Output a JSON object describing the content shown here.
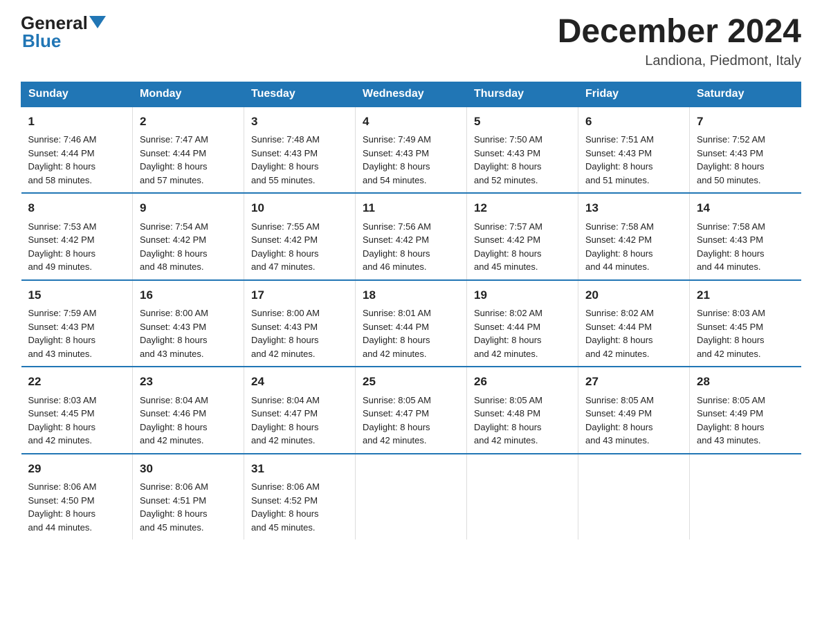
{
  "logo": {
    "general": "General",
    "blue": "Blue",
    "arrow_color": "#2176b5"
  },
  "header": {
    "month_title": "December 2024",
    "location": "Landiona, Piedmont, Italy"
  },
  "days_of_week": [
    "Sunday",
    "Monday",
    "Tuesday",
    "Wednesday",
    "Thursday",
    "Friday",
    "Saturday"
  ],
  "weeks": [
    [
      {
        "day": "1",
        "sunrise": "7:46 AM",
        "sunset": "4:44 PM",
        "daylight": "8 hours and 58 minutes."
      },
      {
        "day": "2",
        "sunrise": "7:47 AM",
        "sunset": "4:44 PM",
        "daylight": "8 hours and 57 minutes."
      },
      {
        "day": "3",
        "sunrise": "7:48 AM",
        "sunset": "4:43 PM",
        "daylight": "8 hours and 55 minutes."
      },
      {
        "day": "4",
        "sunrise": "7:49 AM",
        "sunset": "4:43 PM",
        "daylight": "8 hours and 54 minutes."
      },
      {
        "day": "5",
        "sunrise": "7:50 AM",
        "sunset": "4:43 PM",
        "daylight": "8 hours and 52 minutes."
      },
      {
        "day": "6",
        "sunrise": "7:51 AM",
        "sunset": "4:43 PM",
        "daylight": "8 hours and 51 minutes."
      },
      {
        "day": "7",
        "sunrise": "7:52 AM",
        "sunset": "4:43 PM",
        "daylight": "8 hours and 50 minutes."
      }
    ],
    [
      {
        "day": "8",
        "sunrise": "7:53 AM",
        "sunset": "4:42 PM",
        "daylight": "8 hours and 49 minutes."
      },
      {
        "day": "9",
        "sunrise": "7:54 AM",
        "sunset": "4:42 PM",
        "daylight": "8 hours and 48 minutes."
      },
      {
        "day": "10",
        "sunrise": "7:55 AM",
        "sunset": "4:42 PM",
        "daylight": "8 hours and 47 minutes."
      },
      {
        "day": "11",
        "sunrise": "7:56 AM",
        "sunset": "4:42 PM",
        "daylight": "8 hours and 46 minutes."
      },
      {
        "day": "12",
        "sunrise": "7:57 AM",
        "sunset": "4:42 PM",
        "daylight": "8 hours and 45 minutes."
      },
      {
        "day": "13",
        "sunrise": "7:58 AM",
        "sunset": "4:42 PM",
        "daylight": "8 hours and 44 minutes."
      },
      {
        "day": "14",
        "sunrise": "7:58 AM",
        "sunset": "4:43 PM",
        "daylight": "8 hours and 44 minutes."
      }
    ],
    [
      {
        "day": "15",
        "sunrise": "7:59 AM",
        "sunset": "4:43 PM",
        "daylight": "8 hours and 43 minutes."
      },
      {
        "day": "16",
        "sunrise": "8:00 AM",
        "sunset": "4:43 PM",
        "daylight": "8 hours and 43 minutes."
      },
      {
        "day": "17",
        "sunrise": "8:00 AM",
        "sunset": "4:43 PM",
        "daylight": "8 hours and 42 minutes."
      },
      {
        "day": "18",
        "sunrise": "8:01 AM",
        "sunset": "4:44 PM",
        "daylight": "8 hours and 42 minutes."
      },
      {
        "day": "19",
        "sunrise": "8:02 AM",
        "sunset": "4:44 PM",
        "daylight": "8 hours and 42 minutes."
      },
      {
        "day": "20",
        "sunrise": "8:02 AM",
        "sunset": "4:44 PM",
        "daylight": "8 hours and 42 minutes."
      },
      {
        "day": "21",
        "sunrise": "8:03 AM",
        "sunset": "4:45 PM",
        "daylight": "8 hours and 42 minutes."
      }
    ],
    [
      {
        "day": "22",
        "sunrise": "8:03 AM",
        "sunset": "4:45 PM",
        "daylight": "8 hours and 42 minutes."
      },
      {
        "day": "23",
        "sunrise": "8:04 AM",
        "sunset": "4:46 PM",
        "daylight": "8 hours and 42 minutes."
      },
      {
        "day": "24",
        "sunrise": "8:04 AM",
        "sunset": "4:47 PM",
        "daylight": "8 hours and 42 minutes."
      },
      {
        "day": "25",
        "sunrise": "8:05 AM",
        "sunset": "4:47 PM",
        "daylight": "8 hours and 42 minutes."
      },
      {
        "day": "26",
        "sunrise": "8:05 AM",
        "sunset": "4:48 PM",
        "daylight": "8 hours and 42 minutes."
      },
      {
        "day": "27",
        "sunrise": "8:05 AM",
        "sunset": "4:49 PM",
        "daylight": "8 hours and 43 minutes."
      },
      {
        "day": "28",
        "sunrise": "8:05 AM",
        "sunset": "4:49 PM",
        "daylight": "8 hours and 43 minutes."
      }
    ],
    [
      {
        "day": "29",
        "sunrise": "8:06 AM",
        "sunset": "4:50 PM",
        "daylight": "8 hours and 44 minutes."
      },
      {
        "day": "30",
        "sunrise": "8:06 AM",
        "sunset": "4:51 PM",
        "daylight": "8 hours and 45 minutes."
      },
      {
        "day": "31",
        "sunrise": "8:06 AM",
        "sunset": "4:52 PM",
        "daylight": "8 hours and 45 minutes."
      },
      null,
      null,
      null,
      null
    ]
  ],
  "labels": {
    "sunrise": "Sunrise:",
    "sunset": "Sunset:",
    "daylight": "Daylight:"
  }
}
